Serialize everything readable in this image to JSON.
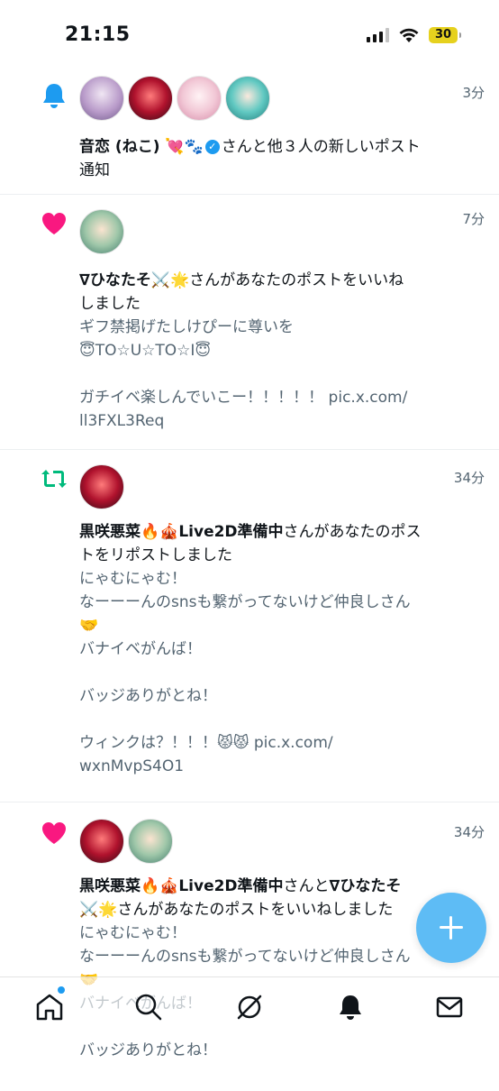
{
  "status_bar": {
    "time": "21:15",
    "battery": "30"
  },
  "notifications": [
    {
      "type": "bell",
      "time": "3分",
      "avatars": [
        "avatar-1",
        "avatar-2",
        "avatar-3",
        "avatar-4"
      ],
      "actor": "音恋 (ねこ) 💘🐾",
      "action": "さんと他３人の新しいポスト",
      "action2": "通知"
    },
    {
      "type": "like",
      "time": "7分",
      "actor": "∇ひなたそ⚔️🌟",
      "action": "さんがあなたのポストをいいね",
      "action2": "しました",
      "body": "ギフ禁掲げたしけぴーに尊いを\n😇TO☆U☆TO☆I😇\n\nガチイベ楽しんでいこー！！！！！ pic.x.com/\nll3FXL3Req"
    },
    {
      "type": "repost",
      "time": "34分",
      "actor": "黒咲悪菜🔥🎪Live2D準備中",
      "action": "さんがあなたのポス",
      "action2": "トをリポストしました",
      "body": "にゃむにゃむ！\nなーーーんのsnsも繋がってないけど仲良しさん\n🤝\nバナイベがんば！\n\nバッジありがとね！\n\nウィンクは？！！！😾😾 pic.x.com/\nwxnMvpS4O1"
    },
    {
      "type": "like",
      "time": "34分",
      "actor": "黒咲悪菜🔥🎪Live2D準備中",
      "action": "さんと",
      "actor2": "∇ひなたそ",
      "action2": "⚔️🌟さんがあなたのポストをいいねしました",
      "body": "にゃむにゃむ！\nなーーーんのsnsも繋がってないけど仲良しさん\n🤝\nバナイベがんば！\n\nバッジありがとね！"
    }
  ],
  "tabs": [
    "home-icon",
    "search-icon",
    "grok-icon",
    "notifications-icon",
    "messages-icon"
  ],
  "colors": {
    "accent": "#1d9bf0",
    "like": "#f91880",
    "repost": "#00ba7c",
    "fab": "#4db5f5"
  }
}
